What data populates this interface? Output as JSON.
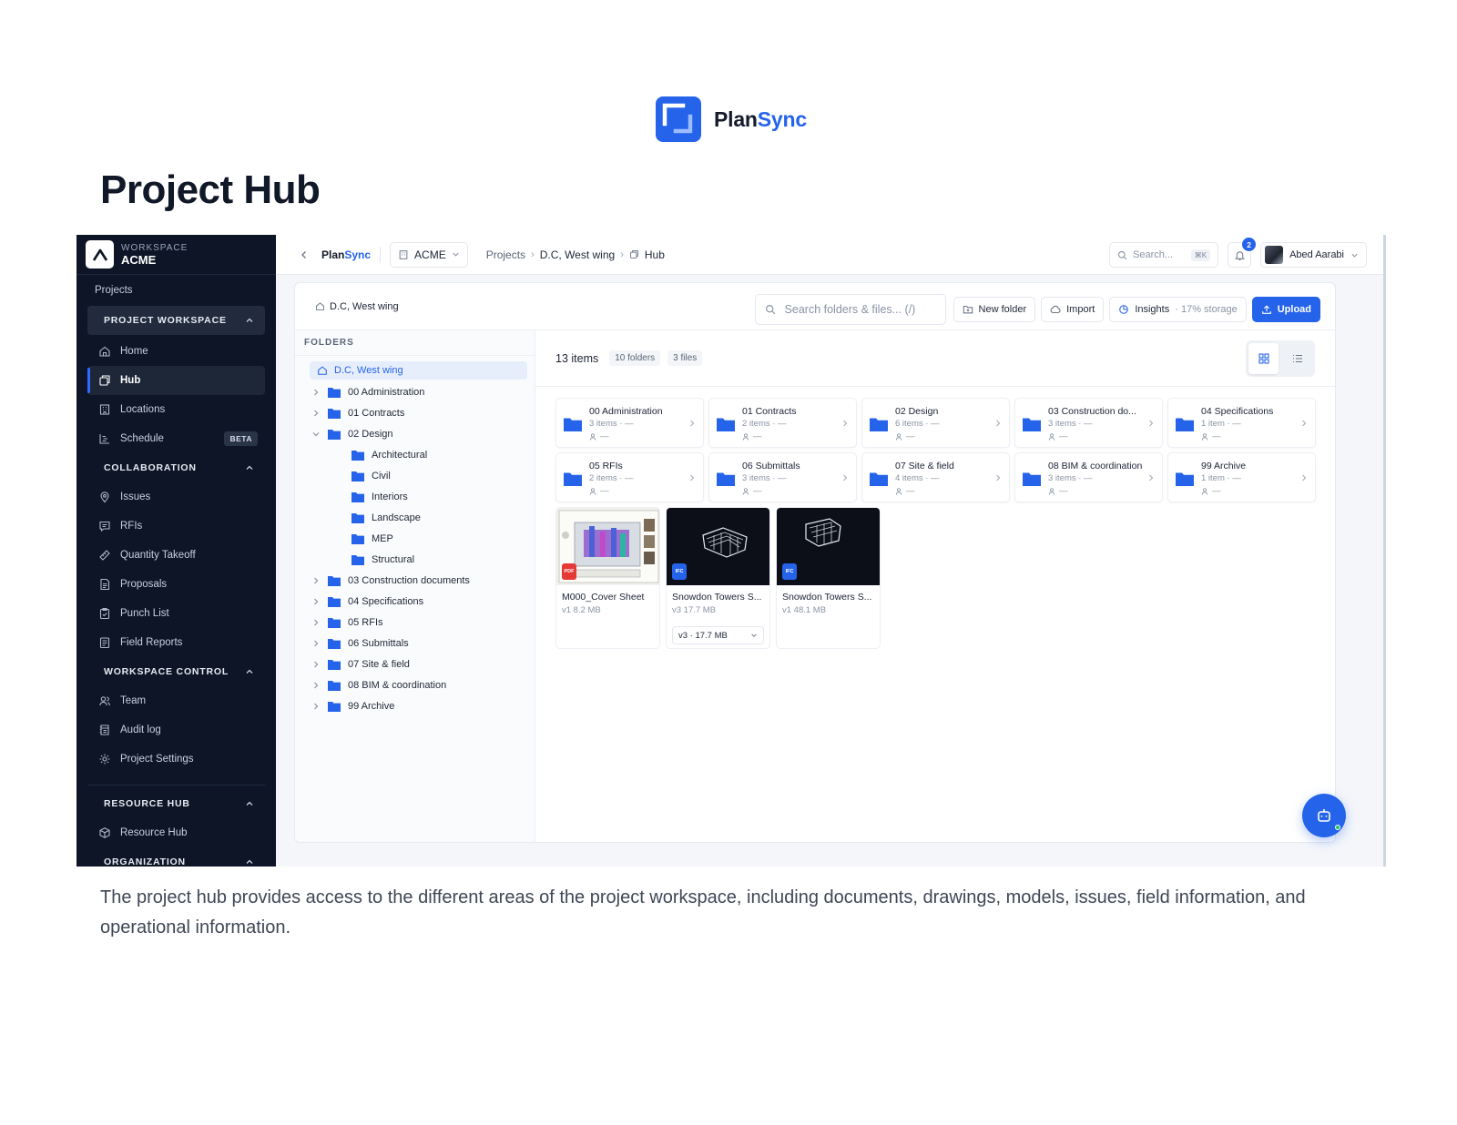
{
  "brand": {
    "name_part1": "Plan",
    "name_part2": "Sync",
    "color": "#2563eb"
  },
  "page_title": "Project Hub",
  "caption": "The project hub provides access to the different areas of the project workspace, including documents, drawings, models, issues, field information, and operational information.",
  "sidebar": {
    "workspace_label": "WORKSPACE",
    "workspace_name": "ACME",
    "projects_label": "Projects",
    "sections": {
      "project_workspace": "PROJECT WORKSPACE",
      "collaboration": "COLLABORATION",
      "workspace_control": "WORKSPACE CONTROL",
      "resource_hub": "RESOURCE HUB",
      "organization": "ORGANIZATION"
    },
    "items": {
      "home": "Home",
      "hub": "Hub",
      "locations": "Locations",
      "schedule": "Schedule",
      "schedule_badge": "BETA",
      "issues": "Issues",
      "rfis": "RFIs",
      "quantity_takeoff": "Quantity Takeoff",
      "proposals": "Proposals",
      "punch_list": "Punch List",
      "field_reports": "Field Reports",
      "team": "Team",
      "audit_log": "Audit log",
      "project_settings": "Project Settings",
      "resource_hub": "Resource Hub"
    },
    "active_item": "Hub"
  },
  "topbar": {
    "brand_part1": "Plan",
    "brand_part2": "Sync",
    "org": "ACME",
    "breadcrumb": {
      "projects": "Projects",
      "project": "D.C, West wing",
      "current": "Hub"
    },
    "search_placeholder": "Search...",
    "search_shortcut": "⌘K",
    "notification_count": "2",
    "user_name": "Abed Aarabi"
  },
  "panel": {
    "breadcrumb": "D.C, West wing",
    "search_placeholder": "Search folders & files... (/)",
    "new_folder": "New folder",
    "import": "Import",
    "insights": "Insights",
    "storage": "· 17% storage",
    "upload": "Upload"
  },
  "tree": {
    "header": "FOLDERS",
    "root": "D.C, West wing",
    "folders": {
      "f00": "00 Administration",
      "f01": "01 Contracts",
      "f02": "02 Design",
      "f02_children": {
        "c1": "Architectural",
        "c2": "Civil",
        "c3": "Interiors",
        "c4": "Landscape",
        "c5": "MEP",
        "c6": "Structural"
      },
      "f03": "03 Construction documents",
      "f04": "04 Specifications",
      "f05": "05 RFIs",
      "f06": "06 Submittals",
      "f07": "07 Site & field",
      "f08": "08 BIM & coordination",
      "f99": "99 Archive"
    }
  },
  "content": {
    "item_count": "13 items",
    "folder_count": "10 folders",
    "file_count": "3 files",
    "view_mode": "grid",
    "folder_cards": [
      {
        "name": "00 Administration",
        "meta": "3 items · —",
        "user": "—"
      },
      {
        "name": "01 Contracts",
        "meta": "2 items · —",
        "user": "—"
      },
      {
        "name": "02 Design",
        "meta": "6 items · —",
        "user": "—"
      },
      {
        "name": "03 Construction do...",
        "meta": "3 items · —",
        "user": "—"
      },
      {
        "name": "04 Specifications",
        "meta": "1 item · —",
        "user": "—"
      },
      {
        "name": "05 RFIs",
        "meta": "2 items · —",
        "user": "—"
      },
      {
        "name": "06 Submittals",
        "meta": "3 items · —",
        "user": "—"
      },
      {
        "name": "07 Site & field",
        "meta": "4 items · —",
        "user": "—"
      },
      {
        "name": "08 BIM & coordination",
        "meta": "3 items · —",
        "user": "—"
      },
      {
        "name": "99 Archive",
        "meta": "1 item · —",
        "user": "—"
      }
    ],
    "files": [
      {
        "name": "M000_Cover Sheet",
        "meta": "v1  8.2 MB",
        "type": "PDF"
      },
      {
        "name": "Snowdon Towers S...",
        "meta": "v3  17.7 MB",
        "type": "IFC",
        "version_select": "v3 · 17.7 MB"
      },
      {
        "name": "Snowdon Towers S...",
        "meta": "v1  48.1 MB",
        "type": "IFC"
      }
    ]
  }
}
